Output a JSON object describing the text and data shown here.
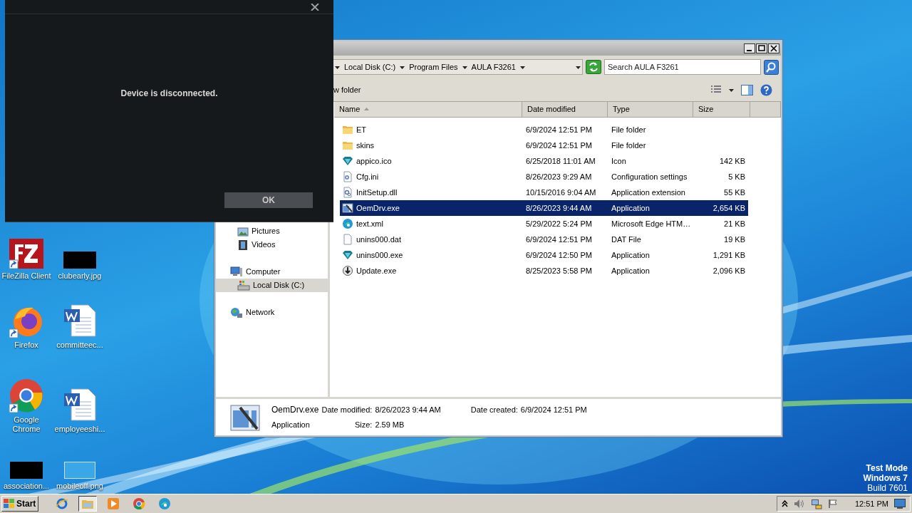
{
  "dialog": {
    "message": "Device is disconnected.",
    "ok_button": "OK"
  },
  "explorer": {
    "breadcrumbs": [
      "Local Disk (C:)",
      "Program Files",
      "AULA F3261"
    ],
    "search": {
      "placeholder": "Search AULA F3261"
    },
    "toolbar": {
      "new_folder": "w folder"
    },
    "nav": [
      {
        "label": "Pictures",
        "kind": "pictures",
        "selected": false
      },
      {
        "label": "Videos",
        "kind": "videos",
        "selected": false
      },
      {
        "label": "Computer",
        "kind": "computer",
        "selected": false,
        "children": [
          {
            "label": "Local Disk (C:)",
            "kind": "drive",
            "selected": true
          }
        ]
      },
      {
        "label": "Network",
        "kind": "network",
        "selected": false
      }
    ],
    "columns": [
      {
        "label": "Name",
        "sorted": true
      },
      {
        "label": "Date modified",
        "sorted": false
      },
      {
        "label": "Type",
        "sorted": false
      },
      {
        "label": "Size",
        "sorted": false
      }
    ],
    "files": [
      {
        "name": "ET",
        "date": "6/9/2024 12:51 PM",
        "type": "File folder",
        "kind": "folder",
        "selected": false
      },
      {
        "name": "skins",
        "date": "6/9/2024 12:51 PM",
        "type": "File folder",
        "kind": "folder",
        "selected": false
      },
      {
        "name": "appico.ico",
        "date": "6/25/2018 11:01 AM",
        "type": "Icon",
        "size": "142 KB",
        "kind": "gem",
        "selected": false
      },
      {
        "name": "Cfg.ini",
        "date": "8/26/2023 9:29 AM",
        "type": "Configuration settings",
        "size": "5 KB",
        "kind": "settings",
        "selected": false
      },
      {
        "name": "InitSetup.dll",
        "date": "10/15/2016 9:04 AM",
        "type": "Application extension",
        "size": "55 KB",
        "kind": "dll",
        "selected": false
      },
      {
        "name": "OemDrv.exe",
        "date": "8/26/2023 9:44 AM",
        "type": "Application",
        "size": "2,654 KB",
        "kind": "app",
        "selected": true
      },
      {
        "name": "text.xml",
        "date": "5/29/2022 5:24 PM",
        "type": "Microsoft Edge HTM…",
        "size": "21 KB",
        "kind": "edge",
        "selected": false
      },
      {
        "name": "unins000.dat",
        "date": "6/9/2024 12:51 PM",
        "type": "DAT File",
        "size": "19 KB",
        "kind": "file",
        "selected": false
      },
      {
        "name": "unins000.exe",
        "date": "6/9/2024 12:50 PM",
        "type": "Application",
        "size": "1,291 KB",
        "kind": "gem",
        "selected": false
      },
      {
        "name": "Update.exe",
        "date": "8/25/2023 5:58 PM",
        "type": "Application",
        "size": "2,096 KB",
        "kind": "update",
        "selected": false
      }
    ],
    "details": {
      "name": "OemDrv.exe",
      "type": "Application",
      "modified_label": "Date modified:",
      "modified": "8/26/2023 9:44 AM",
      "created_label": "Date created:",
      "created": "6/9/2024 12:51 PM",
      "size_label": "Size:",
      "size": "2.59 MB"
    }
  },
  "desktop_icons": [
    {
      "label": "FileZilla Client",
      "kind": "filezilla"
    },
    {
      "label": "clubearly.jpg",
      "kind": "dark_thumb"
    },
    {
      "label": "Firefox",
      "kind": "firefox"
    },
    {
      "label": "committeec...",
      "kind": "word"
    },
    {
      "label": "Google Chrome",
      "kind": "chrome"
    },
    {
      "label": "employeeshi...",
      "kind": "word"
    },
    {
      "label": "association...",
      "kind": "dark_thumb"
    },
    {
      "label": "mobileoff.png",
      "kind": "light_thumb"
    }
  ],
  "taskbar": {
    "start": "Start",
    "apps": [
      {
        "kind": "ie",
        "selected": false
      },
      {
        "kind": "explorer",
        "selected": true
      },
      {
        "kind": "media",
        "selected": false
      },
      {
        "kind": "chrome",
        "selected": false
      },
      {
        "kind": "edge",
        "selected": false
      }
    ],
    "clock": "12:51 PM"
  },
  "os_notice": {
    "line1": "Test Mode",
    "line2": "Windows 7",
    "line3": "Build 7601"
  }
}
